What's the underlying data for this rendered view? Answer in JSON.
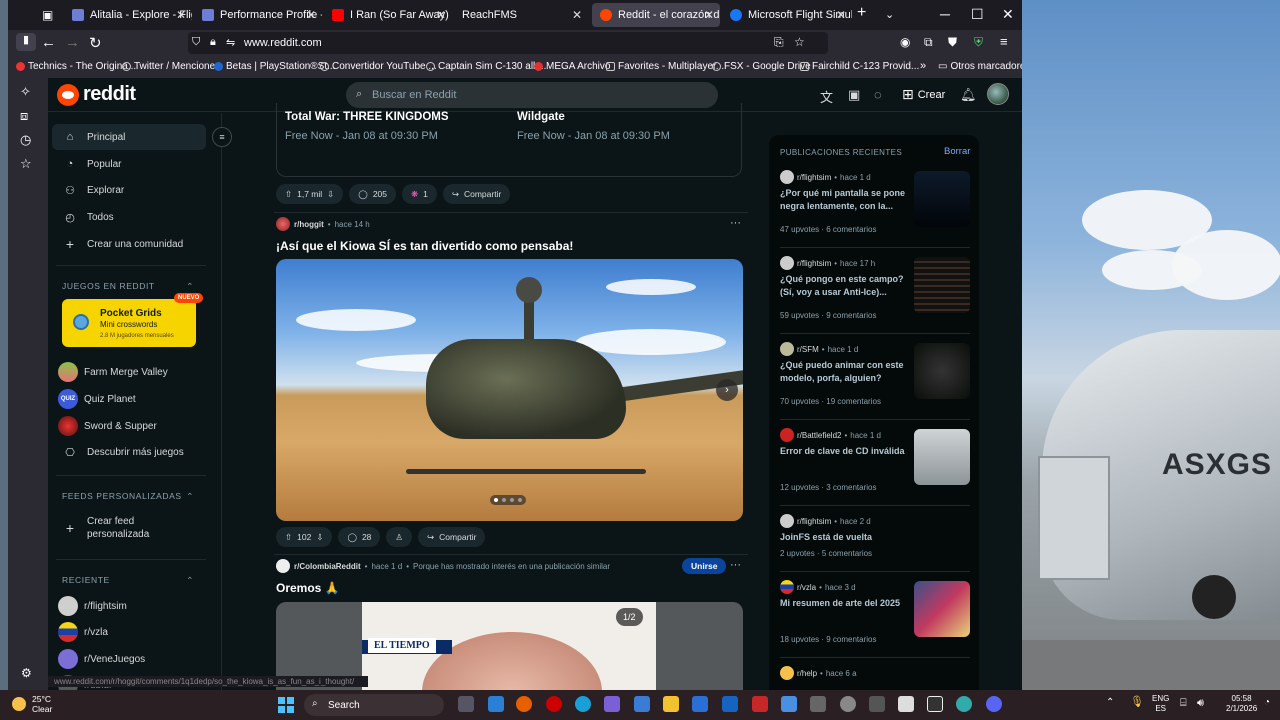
{
  "browser": {
    "tabs": [
      {
        "label": "Alitalia - Explore - Flightsi",
        "color": "#6e7dd6"
      },
      {
        "label": "Performance Profile - Expl",
        "color": "#6e7dd6"
      },
      {
        "label": "I Ran (So Far Away) - YouT",
        "color": "#ff0000"
      },
      {
        "label": "ReachFMS",
        "color": ""
      },
      {
        "label": "Reddit - el corazón de la c",
        "color": "#ff4500"
      },
      {
        "label": "Microsoft Flight Simulator",
        "color": "#1877f2"
      }
    ],
    "new_tab": "+",
    "url": "www.reddit.com",
    "bookmarks": [
      "Technics - The Origina...",
      "Twitter / Menciones",
      "Betas | PlayStation®St...",
      "Convertidor YouTube ...",
      "Captain Sim C-130 all ...",
      "MEGA Archivo",
      "Favorites - Multiplayer...",
      "FSX - Google Drive",
      "Fairchild C-123 Provid...",
      "Otros marcadores"
    ],
    "status_url": "www.reddit.com/r/hoggit/comments/1q1dedp/so_the_kiowa_is_as_fun_as_i_thought/"
  },
  "reddit": {
    "logo": "reddit",
    "search_placeholder": "Buscar en Reddit",
    "create_label": "Crear",
    "nav": [
      {
        "label": "Principal",
        "icon": "home-icon"
      },
      {
        "label": "Popular",
        "icon": "popular-icon"
      },
      {
        "label": "Explorar",
        "icon": "explore-icon"
      },
      {
        "label": "Todos",
        "icon": "all-icon"
      },
      {
        "label": "Crear una comunidad",
        "icon": "plus-icon"
      }
    ],
    "games_header": "JUEGOS EN REDDIT",
    "featured_game": {
      "title": "Pocket Grids",
      "subtitle": "Mini crosswords",
      "meta": "2.8 M jugadores mensuales",
      "badge": "NUEVO"
    },
    "games": [
      "Farm Merge Valley",
      "Quiz Planet",
      "Sword & Supper",
      "Descubrir más juegos"
    ],
    "feeds_header": "FEEDS PERSONALIZADAS",
    "create_feed": "Crear feed personalizada",
    "recent_header": "RECIENTE",
    "recent": [
      "r/flightsim",
      "r/vzla",
      "r/VeneJuegos",
      "r/ubiur"
    ],
    "promo": {
      "games": [
        {
          "name": "Total War: THREE KINGDOMS",
          "date": "Free Now - Jan 08 at 09:30 PM"
        },
        {
          "name": "Wildgate",
          "date": "Free Now - Jan 08 at 09:30 PM"
        }
      ],
      "votes": "1,7 mil",
      "comments": "205",
      "awards": "1",
      "share": "Compartir"
    },
    "post1": {
      "subreddit": "r/hoggit",
      "time": "hace 14 h",
      "title": "¡Así que el Kiowa SÍ es tan divertido como pensaba!",
      "votes": "102",
      "comments": "28",
      "share": "Compartir"
    },
    "post2": {
      "subreddit": "r/ColombiaReddit",
      "time": "hace 1 d",
      "reason": "Porque has mostrado interés en una publicación similar",
      "join": "Unirse",
      "title": "Oremos 🙏",
      "image_label": "EL TIEMPO",
      "counter": "1/2"
    },
    "recent_posts": {
      "header": "PUBLICACIONES RECIENTES",
      "clear": "Borrar",
      "items": [
        {
          "sub": "r/flightsim",
          "time": "hace 1 d",
          "title": "¿Por qué mi pantalla se pone negra lentamente, con la...",
          "upvotes": "47 upvotes",
          "comments": "6 comentarios"
        },
        {
          "sub": "r/flightsim",
          "time": "hace 17 h",
          "title": "¿Qué pongo en este campo? (Sí, voy a usar Anti-Ice)...",
          "upvotes": "59 upvotes",
          "comments": "9 comentarios"
        },
        {
          "sub": "r/SFM",
          "time": "hace 1 d",
          "title": "¿Qué puedo animar con este modelo, porfa, alguien?",
          "upvotes": "70 upvotes",
          "comments": "19 comentarios"
        },
        {
          "sub": "r/Battlefield2",
          "time": "hace 1 d",
          "title": "Error de clave de CD inválida",
          "upvotes": "12 upvotes",
          "comments": "3 comentarios"
        },
        {
          "sub": "r/flightsim",
          "time": "hace 2 d",
          "title": "JoinFS está de vuelta",
          "upvotes": "2 upvotes",
          "comments": "5 comentarios"
        },
        {
          "sub": "r/vzla",
          "time": "hace 3 d",
          "title": "Mi resumen de arte del 2025",
          "upvotes": "18 upvotes",
          "comments": "9 comentarios"
        },
        {
          "sub": "r/help",
          "time": "hace 6 a",
          "title": "",
          "upvotes": "",
          "comments": ""
        }
      ]
    }
  },
  "desktop": {
    "registration": "ASXGS"
  },
  "taskbar": {
    "temp": "25°C",
    "condition": "Clear",
    "search": "Search",
    "lang": "ENG",
    "region": "ES",
    "time": "05:58",
    "date": "2/1/2026"
  }
}
